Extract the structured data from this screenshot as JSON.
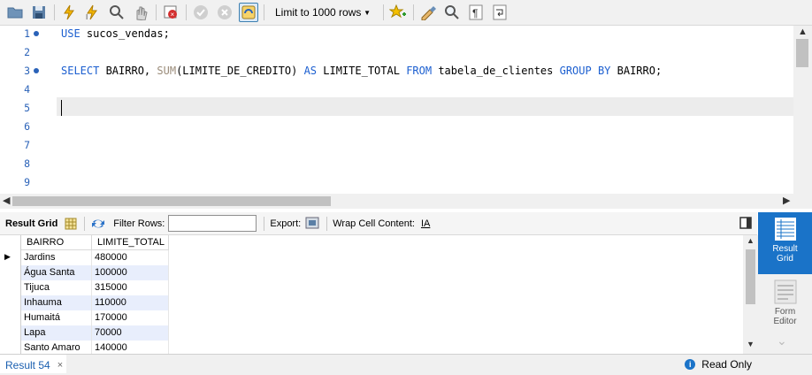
{
  "toolbar": {
    "icons": [
      "open-folder-icon",
      "save-icon",
      "execute-icon",
      "execute-current-icon",
      "explain-icon",
      "stop-icon",
      "toggle-error-icon",
      "commit-icon",
      "rollback-icon",
      "autocommit-icon",
      "snippet-icon",
      "beautify-icon",
      "find-icon",
      "invisible-chars-icon",
      "wrap-icon"
    ],
    "limit_label": "Limit to 1000 rows"
  },
  "editor": {
    "lines": [
      {
        "n": "1",
        "dot": true
      },
      {
        "n": "2",
        "dot": false
      },
      {
        "n": "3",
        "dot": true
      },
      {
        "n": "4",
        "dot": false
      },
      {
        "n": "5",
        "dot": false
      },
      {
        "n": "6",
        "dot": false
      },
      {
        "n": "7",
        "dot": false
      },
      {
        "n": "8",
        "dot": false
      },
      {
        "n": "9",
        "dot": false
      }
    ],
    "line1": {
      "kw_use": "USE",
      "rest": " sucos_vendas;"
    },
    "line3": {
      "kw_select": "SELECT",
      "t1": " BAIRRO, ",
      "fn_sum": "SUM",
      "t2": "(LIMITE_DE_CREDITO) ",
      "kw_as": "AS",
      "t3": " LIMITE_TOTAL ",
      "kw_from": "FROM",
      "t4": " tabela_de_clientes ",
      "kw_group": "GROUP BY",
      "t5": " BAIRRO;"
    }
  },
  "result_toolbar": {
    "result_grid": "Result Grid",
    "filter_rows": "Filter Rows:",
    "export": "Export:",
    "wrap_cell": "Wrap Cell Content:"
  },
  "grid": {
    "columns": [
      "BAIRRO",
      "LIMITE_TOTAL"
    ],
    "rows": [
      [
        "Jardins",
        "480000"
      ],
      [
        "Água Santa",
        "100000"
      ],
      [
        "Tijuca",
        "315000"
      ],
      [
        "Inhauma",
        "110000"
      ],
      [
        "Humaitá",
        "170000"
      ],
      [
        "Lapa",
        "70000"
      ],
      [
        "Santo Amaro",
        "140000"
      ]
    ]
  },
  "side_panel": {
    "result_grid": "Result Grid",
    "form_editor": "Form Editor"
  },
  "status": {
    "tab_label": "Result 54",
    "tab_close": "×",
    "read_only": "Read Only"
  },
  "colors": {
    "keyword": "#1c5fd0",
    "function": "#9b8c7a",
    "line_number": "#2a62b8",
    "accent": "#1a73c8",
    "row_alt": "#e8eefc"
  }
}
